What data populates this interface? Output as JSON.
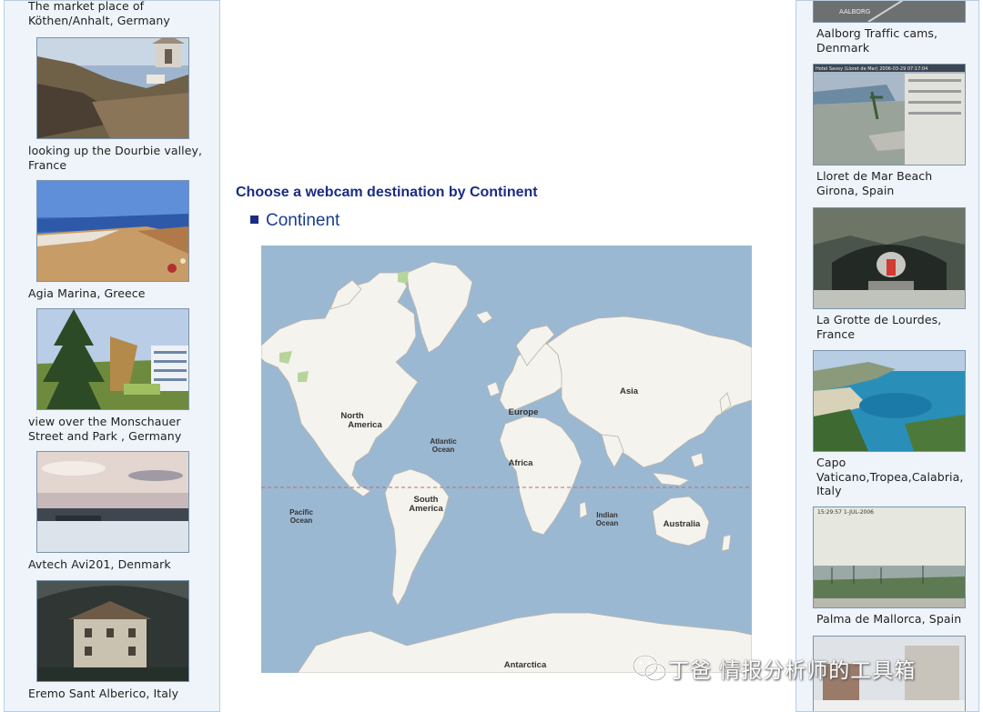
{
  "left_sidebar": {
    "items": [
      {
        "caption": "The market place of Köthen/Anhalt, Germany"
      },
      {
        "caption": "looking up the Dourbie valley, France"
      },
      {
        "caption": "Agia Marina, Greece"
      },
      {
        "caption": "view over the Monschauer Street and Park , Germany"
      },
      {
        "caption": "Avtech Avi201, Denmark"
      },
      {
        "caption": "Eremo Sant Alberico, Italy"
      }
    ]
  },
  "main": {
    "heading": "Choose a webcam destination by Continent",
    "continent_label": "Continent",
    "map": {
      "labels": {
        "north_america": [
          "North",
          "America"
        ],
        "south_america": [
          "South",
          "America"
        ],
        "europe": "Europe",
        "africa": "Africa",
        "asia": "Asia",
        "australia": "Australia",
        "antarctica": "Antarctica",
        "atlantic_ocean": [
          "Atlantic",
          "Ocean"
        ],
        "pacific_ocean": [
          "Pacific",
          "Ocean"
        ],
        "indian_ocean": [
          "Indian",
          "Ocean"
        ]
      },
      "colors": {
        "ocean": "#9bb8d3",
        "land": "#f4f3ee",
        "border": "#b9b4a8",
        "equator": "#b07070"
      }
    }
  },
  "right_sidebar": {
    "items": [
      {
        "caption": "Aalborg Traffic cams, Denmark",
        "overlay": "AALBORG"
      },
      {
        "caption": "Lloret de Mar Beach Girona, Spain",
        "overlay": "Hotel Savoy (Lloret de Mar) 2006-03-29 07:17:04"
      },
      {
        "caption": "La Grotte de Lourdes, France"
      },
      {
        "caption": "Capo Vaticano,Tropea,Calabria, Italy"
      },
      {
        "caption": "Palma de Mallorca, Spain",
        "overlay": "15:29:57  1-JUL-2006"
      }
    ]
  },
  "watermark": {
    "text": "丁爸 情报分析师的工具箱",
    "icon": "wechat-icon"
  }
}
